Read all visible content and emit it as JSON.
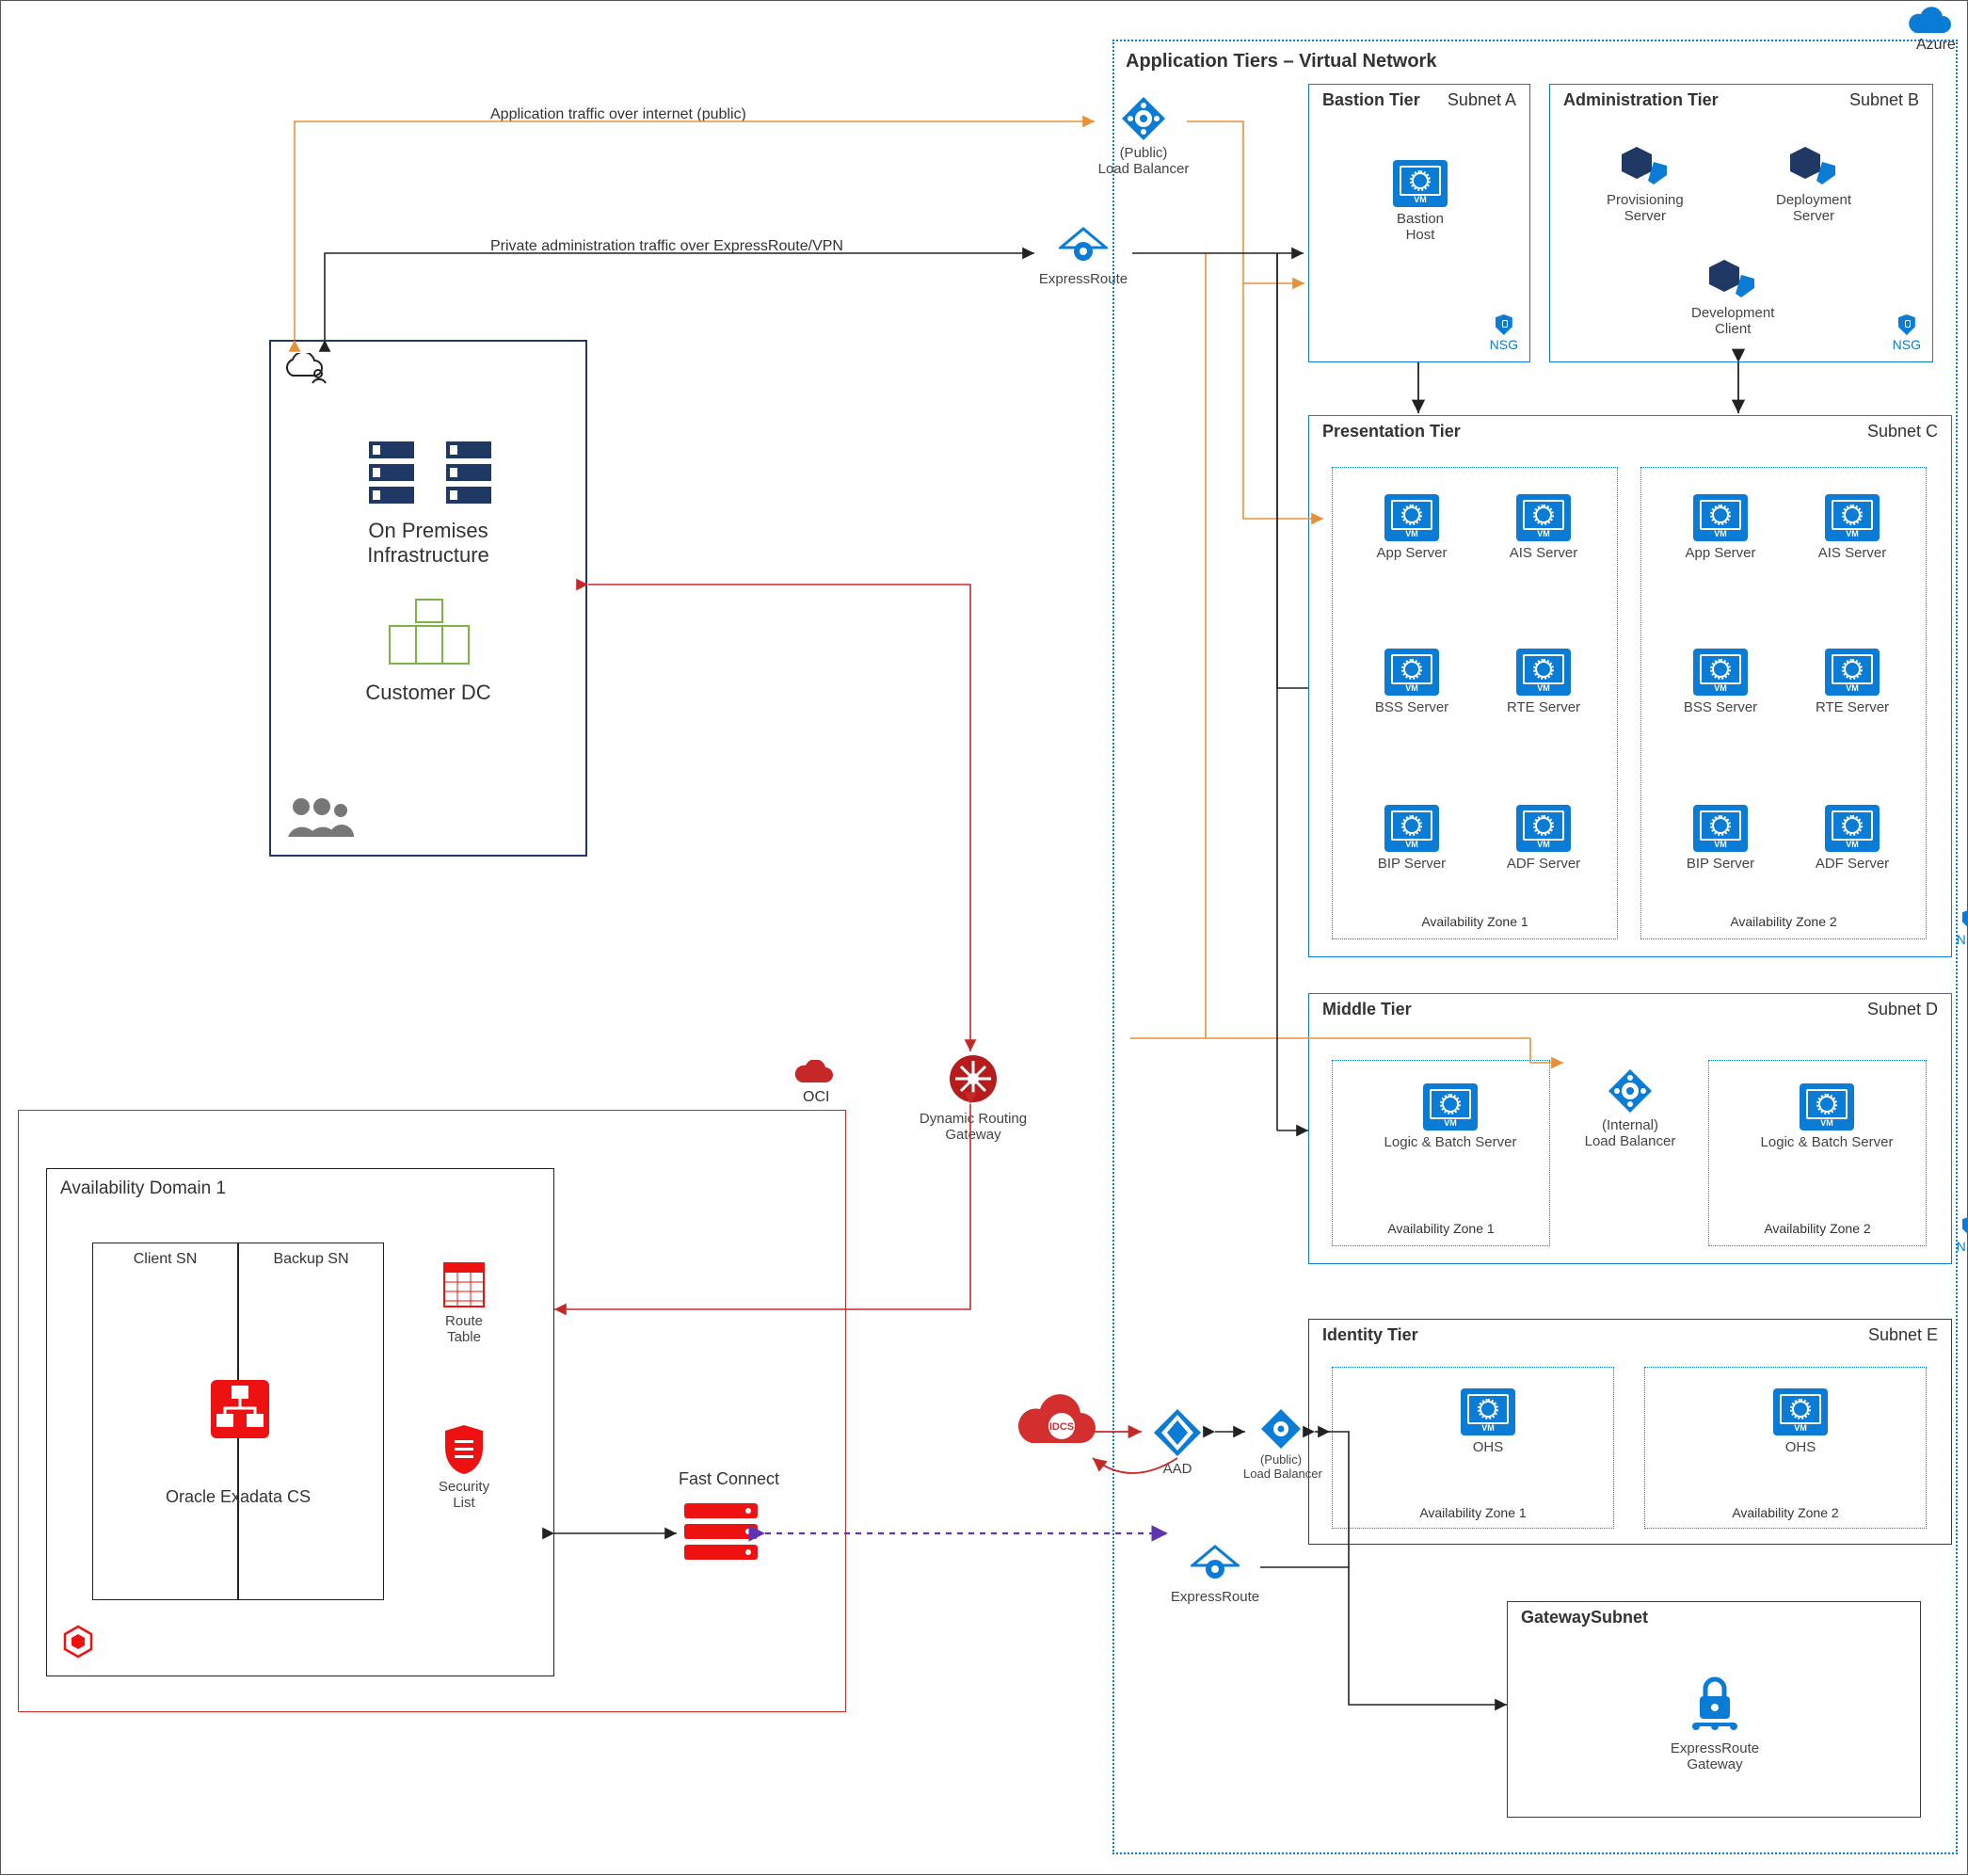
{
  "azure_label": "Azure",
  "vnet_title": "Application Tiers – Virtual Network",
  "bastion_tier": {
    "title": "Bastion Tier",
    "subnet": "Subnet A",
    "host": "Bastion Host"
  },
  "admin_tier": {
    "title": "Administration Tier",
    "subnet": "Subnet B",
    "prov": "Provisioning\nServer",
    "dep": "Deployment\nServer",
    "dev": "Development\nClient"
  },
  "presentation": {
    "title": "Presentation Tier",
    "subnet": "Subnet C",
    "servers": [
      "App Server",
      "AIS Server",
      "BSS Server",
      "RTE Server",
      "BIP Server",
      "ADF Server"
    ],
    "az1": "Availability Zone 1",
    "az2": "Availability Zone 2"
  },
  "middle": {
    "title": "Middle Tier",
    "subnet": "Subnet D",
    "lb": "(Internal)\nLoad Balancer",
    "server": "Logic & Batch Server",
    "az1": "Availability Zone 1",
    "az2": "Availability Zone 2"
  },
  "identity": {
    "title": "Identity Tier",
    "subnet": "Subnet E",
    "server": "OHS",
    "az1": "Availability Zone 1",
    "az2": "Availability Zone 2"
  },
  "gateway": {
    "title": "GatewaySubnet",
    "label": "ExpressRoute Gateway"
  },
  "public_lb": "(Public)\nLoad Balancer",
  "identity_lb": "(Public)\nLoad Balancer",
  "expressroute": "ExpressRoute",
  "expressroute2": "ExpressRoute",
  "aad": "AAD",
  "idcs": "IDCS",
  "nsg": "NSG",
  "traffic_public": "Application traffic over internet (public)",
  "traffic_private": "Private administration traffic over ExpressRoute/VPN",
  "onprem": {
    "infra": "On Premises\nInfrastructure",
    "dc": "Customer DC"
  },
  "oci_label": "OCI",
  "drg": "Dynamic Routing Gateway",
  "fastconnect": "Fast Connect",
  "ad": {
    "title": "Availability Domain 1",
    "client": "Client SN",
    "backup": "Backup SN",
    "exadata": "Oracle Exadata CS",
    "route": "Route\nTable",
    "security": "Security\nList"
  }
}
